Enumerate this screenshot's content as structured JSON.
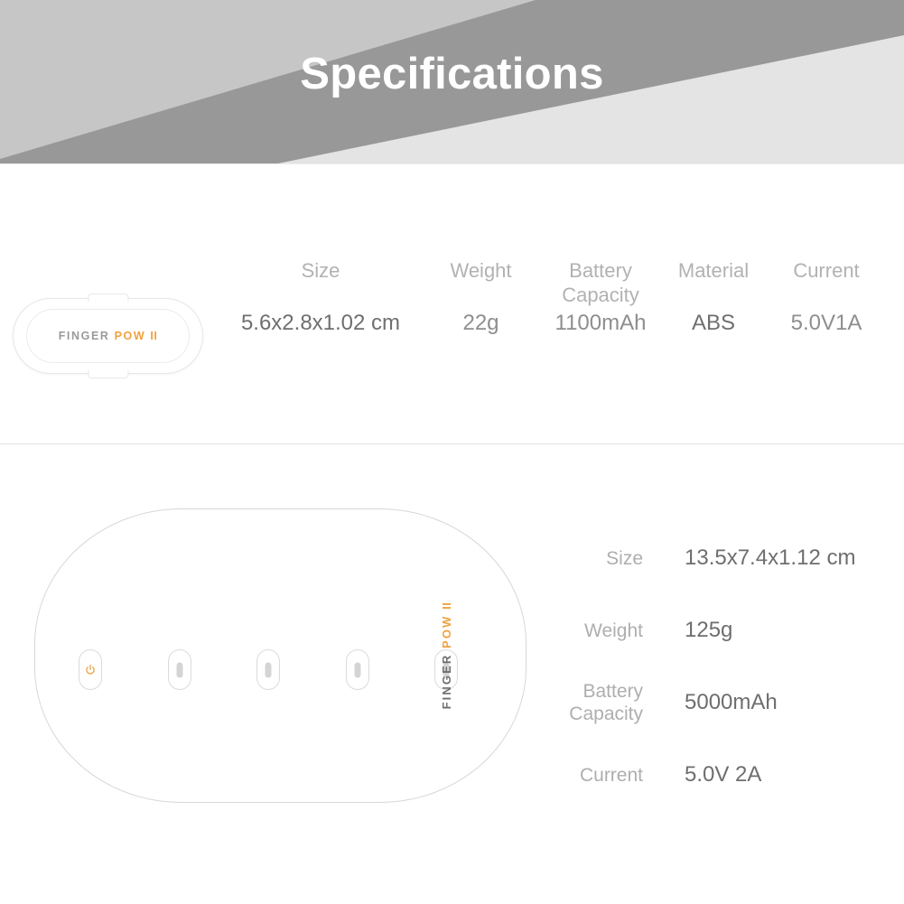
{
  "header": {
    "title": "Specifications",
    "colors": {
      "band": "#989898",
      "left_wedge": "#c6c6c6",
      "right_wedge": "#e4e4e4",
      "title_color": "#ffffff"
    }
  },
  "brand": {
    "name_part1": "FINGER",
    "name_part2": "POW",
    "name_part3": "II",
    "accent_color": "#efa23e"
  },
  "section_small": {
    "product_logo": {
      "part1": "FINGER",
      "part2": "POW",
      "part3": "II"
    },
    "specs": [
      {
        "label": "Size",
        "value": "5.6x2.8x1.02 cm"
      },
      {
        "label": "Weight",
        "value": "22g"
      },
      {
        "label_line1": "Battery",
        "label_line2": "Capacity",
        "value": "1100mAh"
      },
      {
        "label": "Material",
        "value": "ABS"
      },
      {
        "label": "Current",
        "value": "5.0V1A"
      }
    ]
  },
  "section_large": {
    "product_logo": {
      "part1": "FINGER",
      "part2": "POW",
      "part3": "II"
    },
    "slots": [
      {
        "name": "power-slot",
        "icon": "power-icon"
      },
      {
        "name": "charge-slot",
        "icon": "contact-pin"
      },
      {
        "name": "charge-slot",
        "icon": "contact-pin"
      },
      {
        "name": "charge-slot",
        "icon": "contact-pin"
      },
      {
        "name": "charge-slot",
        "icon": "contact-pin"
      }
    ],
    "specs": [
      {
        "label": "Size",
        "value": "13.5x7.4x1.12 cm"
      },
      {
        "label": "Weight",
        "value": "125g"
      },
      {
        "label_line1": "Battery",
        "label_line2": "Capacity",
        "value": "5000mAh"
      },
      {
        "label": "Current",
        "value": "5.0V 2A"
      }
    ]
  }
}
